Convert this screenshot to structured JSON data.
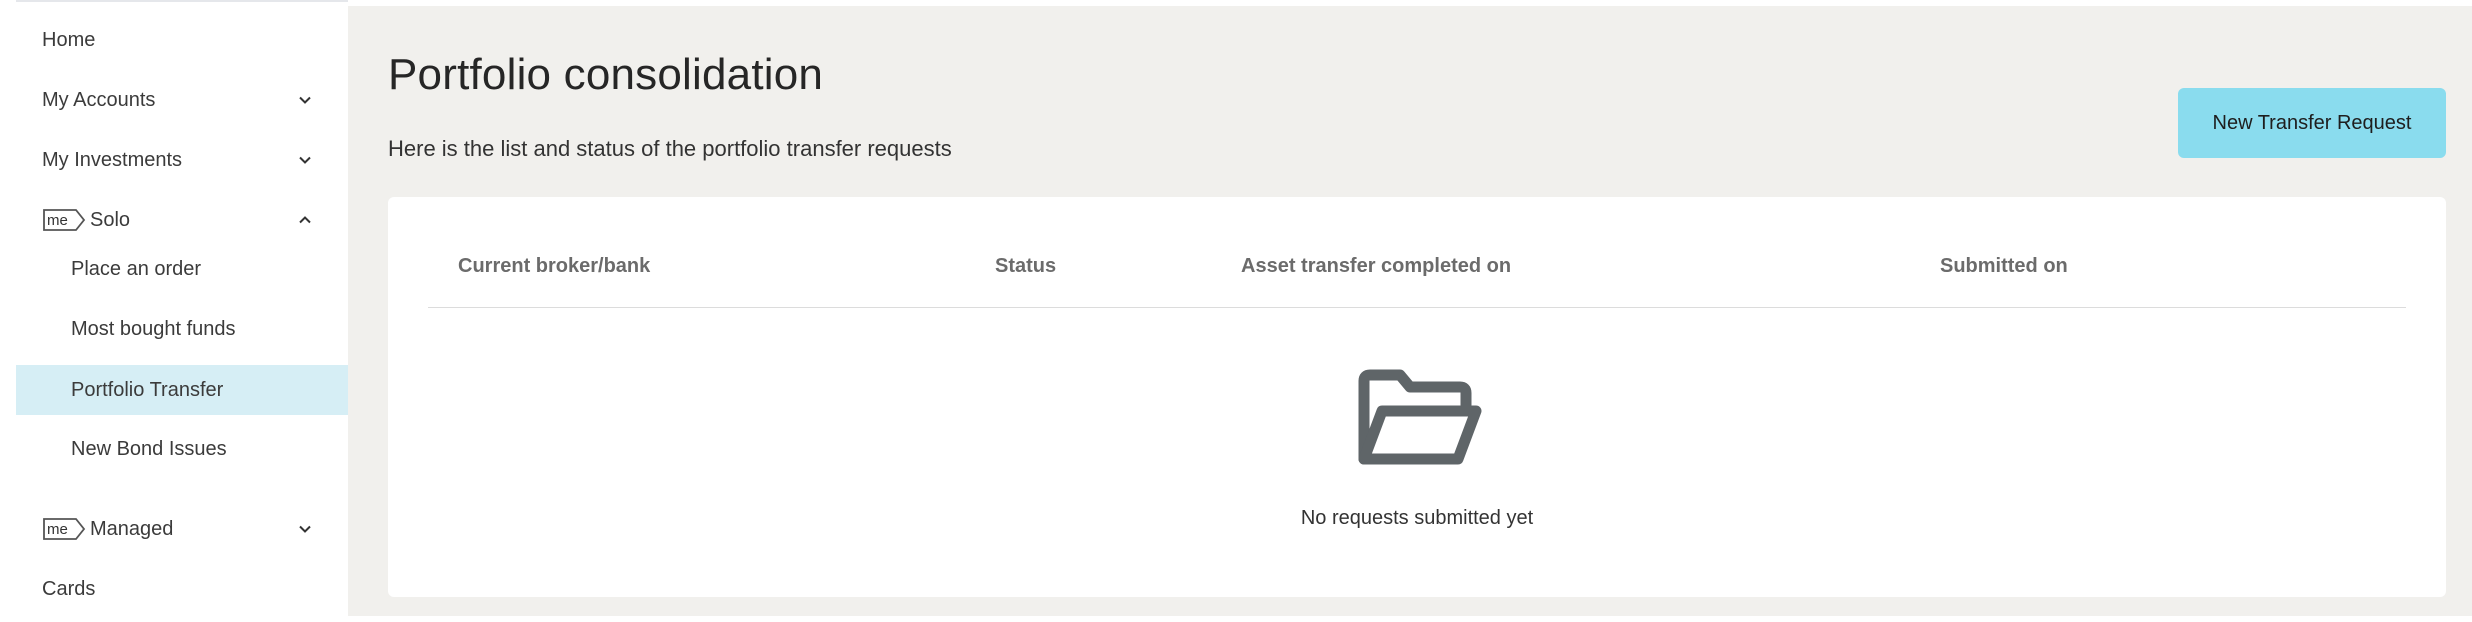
{
  "sidebar": {
    "items": [
      {
        "label": "Home"
      },
      {
        "label": "My Accounts",
        "chevron": "down"
      },
      {
        "label": "My Investments",
        "chevron": "down"
      },
      {
        "label": "Solo",
        "logo": "me",
        "chevron": "up"
      },
      {
        "label": "Place an order"
      },
      {
        "label": "Most bought funds"
      },
      {
        "label": "Portfolio Transfer",
        "active": true
      },
      {
        "label": "New Bond Issues"
      },
      {
        "label": "Managed",
        "logo": "me",
        "chevron": "down"
      },
      {
        "label": "Cards"
      }
    ],
    "logo_text": "me"
  },
  "main": {
    "title": "Portfolio consolidation",
    "subtitle": "Here is the list and status of the portfolio transfer requests",
    "new_button_label": "New Transfer Request",
    "table": {
      "columns": [
        "Current broker/bank",
        "Status",
        "Asset transfer completed on",
        "Submitted on"
      ],
      "rows": []
    },
    "empty_state": {
      "icon": "folder-open-icon",
      "text": "No requests submitted yet"
    }
  },
  "colors": {
    "main_bg": "#f1f0ed",
    "accent_button": "#8adcee",
    "active_nav": "#d6eef5",
    "icon_gray": "#5f6568"
  }
}
